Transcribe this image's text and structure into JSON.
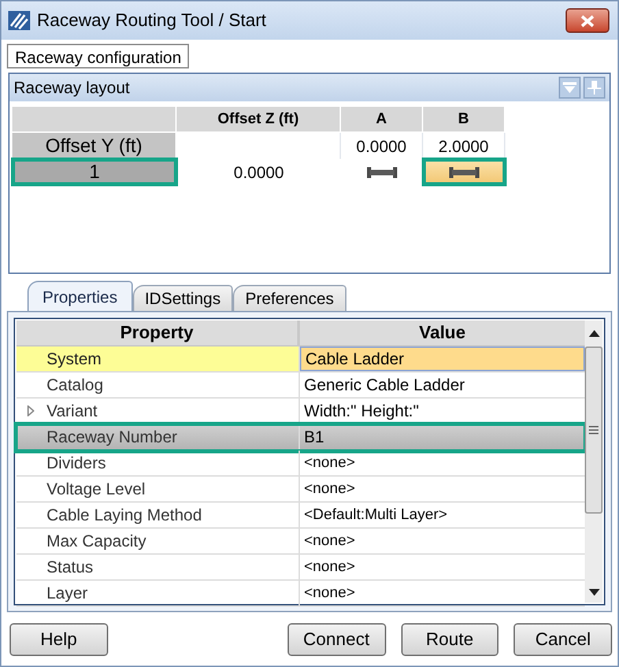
{
  "window": {
    "title": "Raceway Routing Tool / Start"
  },
  "top_tabs": [
    {
      "label": "Raceway configuration",
      "selected": true
    }
  ],
  "layout_panel": {
    "title": "Raceway layout",
    "columns": [
      "Offset Z (ft)",
      "A",
      "B"
    ],
    "offset_y": {
      "label": "Offset Y (ft)",
      "values": [
        "0.0000",
        "2.0000"
      ]
    },
    "rows": [
      {
        "label": "1",
        "highlighted": true,
        "offset_z": "0.0000",
        "cells": [
          {
            "kind": "raceway",
            "selected": false,
            "highlighted": false
          },
          {
            "kind": "raceway",
            "selected": true,
            "highlighted": true
          }
        ]
      }
    ]
  },
  "tabs": [
    {
      "label": "Properties",
      "selected": true
    },
    {
      "label": "IDSettings",
      "selected": false
    },
    {
      "label": "Preferences",
      "selected": false
    }
  ],
  "properties": {
    "columns": [
      "Property",
      "Value"
    ],
    "rows": [
      {
        "name": "System",
        "value": "Cable Ladder",
        "selected": true,
        "highlighted": false,
        "expandable": false
      },
      {
        "name": "Catalog",
        "value": "Generic Cable Ladder",
        "selected": false,
        "highlighted": false,
        "expandable": false
      },
      {
        "name": "Variant",
        "value": "Width:\" Height:\"",
        "selected": false,
        "highlighted": false,
        "expandable": true
      },
      {
        "name": "Raceway Number",
        "value": "B1",
        "selected": false,
        "highlighted": true,
        "expandable": false
      },
      {
        "name": "Dividers",
        "value": "<none>",
        "selected": false,
        "highlighted": false,
        "expandable": false
      },
      {
        "name": "Voltage Level",
        "value": "<none>",
        "selected": false,
        "highlighted": false,
        "expandable": false
      },
      {
        "name": "Cable Laying Method",
        "value": "<Default:Multi Layer>",
        "selected": false,
        "highlighted": false,
        "expandable": false
      },
      {
        "name": "Max Capacity",
        "value": "<none>",
        "selected": false,
        "highlighted": false,
        "expandable": false
      },
      {
        "name": "Status",
        "value": "<none>",
        "selected": false,
        "highlighted": false,
        "expandable": false
      },
      {
        "name": "Layer",
        "value": "<none>",
        "selected": false,
        "highlighted": false,
        "expandable": false
      }
    ]
  },
  "buttons": [
    {
      "label": "Help"
    },
    {
      "label": "Connect"
    },
    {
      "label": "Route"
    },
    {
      "label": "Cancel"
    }
  ]
}
